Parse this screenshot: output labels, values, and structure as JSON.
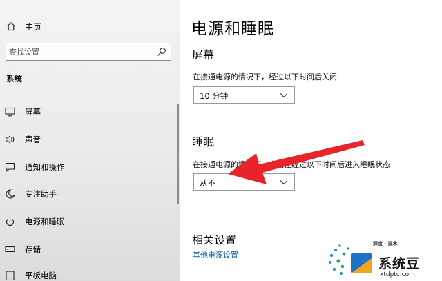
{
  "sidebar": {
    "home_label": "主页",
    "search_placeholder": "查找设置",
    "section_title": "系统",
    "items": [
      {
        "label": "屏幕",
        "icon": "monitor-icon"
      },
      {
        "label": "声音",
        "icon": "speaker-icon"
      },
      {
        "label": "通知和操作",
        "icon": "notification-icon"
      },
      {
        "label": "专注助手",
        "icon": "moon-icon"
      },
      {
        "label": "电源和睡眠",
        "icon": "power-icon"
      },
      {
        "label": "存储",
        "icon": "storage-icon"
      },
      {
        "label": "平板电脑",
        "icon": "tablet-icon"
      }
    ]
  },
  "main": {
    "title": "电源和睡眠",
    "screen": {
      "heading": "屏幕",
      "description": "在接通电源的情况下，经过以下时间后关闭",
      "value": "10 分钟"
    },
    "sleep": {
      "heading": "睡眠",
      "description": "在接通电源的情况下，电脑在经过以下时间后进入睡眠状态",
      "value": "从不"
    },
    "related": {
      "heading": "相关设置",
      "link": "其他电源设置"
    }
  },
  "annotation": {
    "arrow_color": "#e8232a"
  },
  "watermark": {
    "tag": "深度 · 技术",
    "name": "系统豆",
    "url": "xtdptc.com"
  }
}
